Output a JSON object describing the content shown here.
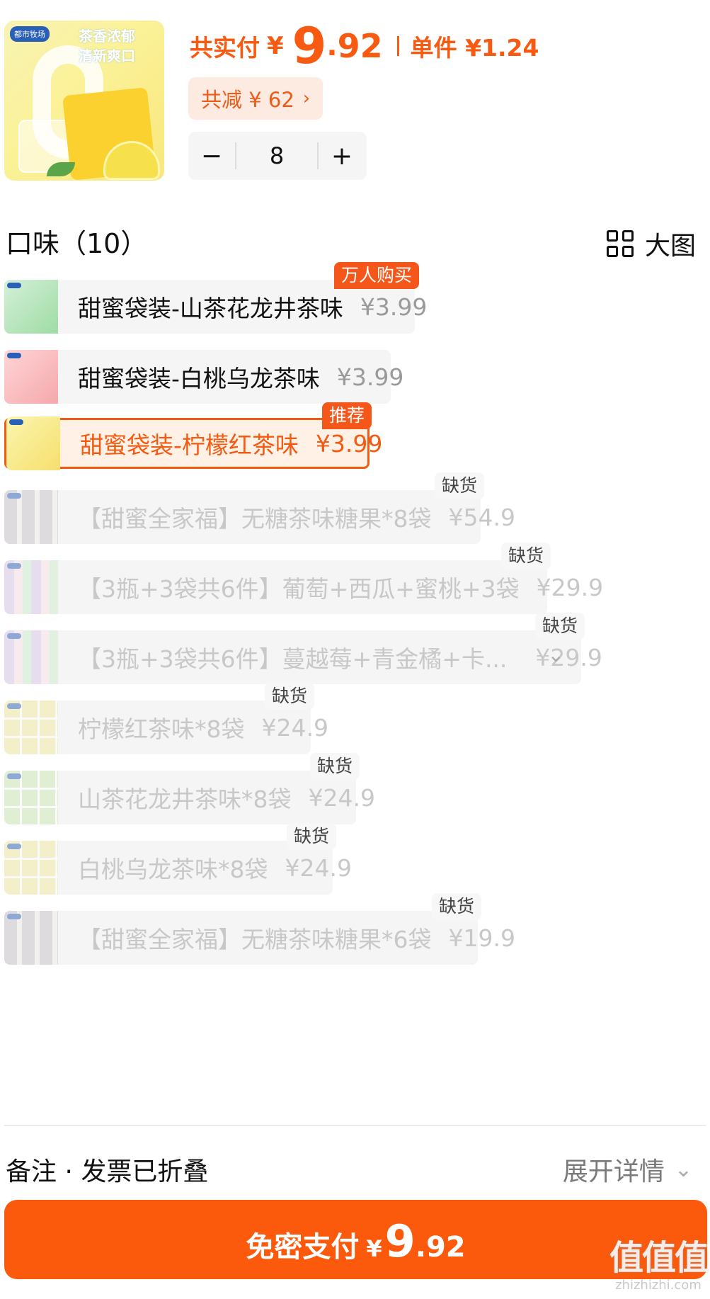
{
  "header": {
    "brand": "都市牧场",
    "slogan_line1": "茶香浓郁",
    "slogan_line2": "清新爽口",
    "total_label": "共实付",
    "currency": "¥",
    "total_int": "9",
    "total_dot": ".",
    "total_dec": "92",
    "unit_price": "单件 ¥1.24",
    "discount": "共减 ¥ 62",
    "discount_chevron": "›",
    "minus": "−",
    "plus": "+",
    "quantity": "8"
  },
  "flavor": {
    "title": "口味（10）",
    "big_view": "大图",
    "options": [
      {
        "name": "甜蜜袋装-山茶花龙井茶味",
        "price": "¥3.99",
        "tag": "万人购买",
        "state": "normal",
        "pic": "green"
      },
      {
        "name": "甜蜜袋装-白桃乌龙茶味",
        "price": "¥3.99",
        "tag": "",
        "state": "normal",
        "pic": "pink"
      },
      {
        "name": "甜蜜袋装-柠檬红茶味",
        "price": "¥3.99",
        "tag": "推荐",
        "state": "selected",
        "pic": "yellow"
      },
      {
        "name": "【甜蜜全家福】无糖茶味糖果*8袋",
        "price": "¥54.9",
        "tag": "缺货",
        "state": "out",
        "pic": "mixed"
      },
      {
        "name": "【3瓶+3袋共6件】葡萄+西瓜+蜜桃+3袋",
        "price": "¥29.9",
        "tag": "缺货",
        "state": "out",
        "pic": "bottles"
      },
      {
        "name": "【3瓶+3袋共6件】蔓越莓+青金橘+卡...",
        "price": "¥29.9",
        "tag": "缺货",
        "state": "out",
        "pic": "bottles"
      },
      {
        "name": "柠檬红茶味*8袋",
        "price": "¥24.9",
        "tag": "缺货",
        "state": "out",
        "pic": "grid9"
      },
      {
        "name": "山茶花龙井茶味*8袋",
        "price": "¥24.9",
        "tag": "缺货",
        "state": "out",
        "pic": "grid9g"
      },
      {
        "name": "白桃乌龙茶味*8袋",
        "price": "¥24.9",
        "tag": "缺货",
        "state": "out",
        "pic": "grid9"
      },
      {
        "name": "【甜蜜全家福】无糖茶味糖果*6袋",
        "price": "¥19.9",
        "tag": "缺货",
        "state": "out",
        "pic": "mixed"
      }
    ],
    "expand_caret": "⌄"
  },
  "footer": {
    "remark": "备注 · 发票已折叠",
    "expand": "展开详情",
    "expand_chevron": "⌄",
    "pay_label": "免密支付",
    "pay_currency": "¥",
    "pay_int": "9",
    "pay_dot": ".",
    "pay_dec": "92"
  },
  "watermark": {
    "mark": "值值值",
    "site": "zhizhizhi.com"
  },
  "colors": {
    "accent": "#f75a10",
    "pay_button": "#fb5a0c",
    "selected_bg": "#fff1e6",
    "option_bg": "#f5f5f5",
    "disabled_text": "#c8c8c8"
  }
}
